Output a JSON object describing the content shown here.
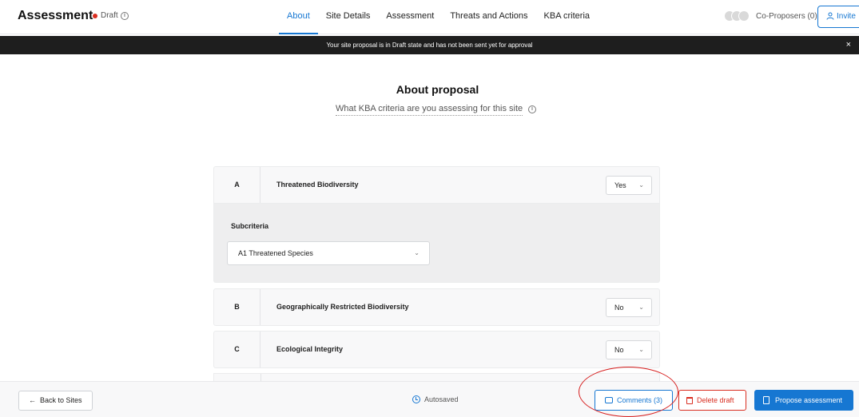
{
  "header": {
    "title": "Assessment",
    "status": "Draft",
    "tabs": [
      "About",
      "Site Details",
      "Assessment",
      "Threats and Actions",
      "KBA criteria"
    ],
    "active_tab": "About",
    "coproposers_label": "Co-Proposers (0)",
    "invite_label": "Invite"
  },
  "banner": {
    "text": "Your site proposal is in Draft state and has not been sent yet for approval",
    "close": "×"
  },
  "main": {
    "title": "About proposal",
    "subtitle": "What KBA criteria are you assessing for this site"
  },
  "criteria": [
    {
      "letter": "A",
      "name": "Threatened Biodiversity",
      "value": "Yes"
    },
    {
      "letter": "B",
      "name": "Geographically Restricted Biodiversity",
      "value": "No"
    },
    {
      "letter": "C",
      "name": "Ecological Integrity",
      "value": "No"
    }
  ],
  "subcriteria": {
    "label": "Subcriteria",
    "selected": "A1 Threatened Species"
  },
  "footer": {
    "back_label": "Back to Sites",
    "autosaved": "Autosaved",
    "comments_label": "Comments (3)",
    "delete_label": "Delete draft",
    "propose_label": "Propose assessment"
  },
  "colors": {
    "accent": "#1677d2",
    "danger": "#d92d20",
    "banner": "#1e1e1e",
    "annotation": "#d61f1f"
  },
  "icons": {
    "draft_dot": "red-dot",
    "info": "info-icon",
    "invite": "user-icon",
    "close": "close-icon",
    "dropdown": "chevron-down-icon",
    "back": "arrow-left-icon",
    "autosaved": "clock-icon",
    "comments": "comment-icon",
    "delete": "trash-icon",
    "propose": "document-icon"
  }
}
